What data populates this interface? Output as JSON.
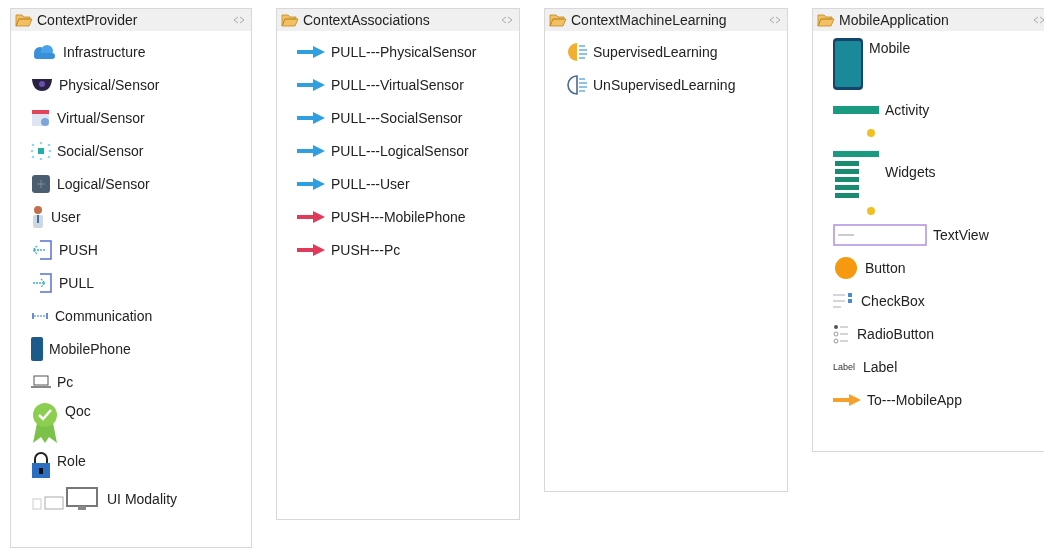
{
  "panels": [
    {
      "title": "ContextProvider",
      "items": [
        {
          "label": "Infrastructure",
          "kind": "cloud"
        },
        {
          "label": "Physical/Sensor",
          "kind": "camera"
        },
        {
          "label": "Virtual/Sensor",
          "kind": "calendar"
        },
        {
          "label": "Social/Sensor",
          "kind": "dots"
        },
        {
          "label": "Logical/Sensor",
          "kind": "chip"
        },
        {
          "label": "User",
          "kind": "person"
        },
        {
          "label": "PUSH",
          "kind": "push"
        },
        {
          "label": "PULL",
          "kind": "pull"
        },
        {
          "label": "Communication",
          "kind": "link"
        },
        {
          "label": "MobilePhone",
          "kind": "phone"
        },
        {
          "label": "Pc",
          "kind": "laptop"
        },
        {
          "label": "Qoc",
          "kind": "award"
        },
        {
          "label": "Role",
          "kind": "lock"
        },
        {
          "label": "UI Modality",
          "kind": "devices"
        }
      ]
    },
    {
      "title": "ContextAssociations",
      "items": [
        {
          "label": "PULL---PhysicalSensor",
          "kind": "arrow-blue"
        },
        {
          "label": "PULL---VirtualSensor",
          "kind": "arrow-blue"
        },
        {
          "label": "PULL---SocialSensor",
          "kind": "arrow-blue"
        },
        {
          "label": "PULL---LogicalSensor",
          "kind": "arrow-blue"
        },
        {
          "label": "PULL---User",
          "kind": "arrow-blue"
        },
        {
          "label": "PUSH---MobilePhone",
          "kind": "arrow-red"
        },
        {
          "label": "PUSH---Pc",
          "kind": "arrow-red"
        }
      ]
    },
    {
      "title": "ContextMachineLearning",
      "items": [
        {
          "label": "SupervisedLearning",
          "kind": "brain-yellow"
        },
        {
          "label": "UnSupervisedLearning",
          "kind": "brain-blue"
        }
      ]
    },
    {
      "title": "MobileApplication",
      "items": [
        {
          "label": "Mobile",
          "kind": "mobile"
        },
        {
          "label": "Activity",
          "kind": "activity"
        },
        {
          "label": "Widgets",
          "kind": "widgets"
        },
        {
          "label": "TextView",
          "kind": "textview"
        },
        {
          "label": "Button",
          "kind": "button"
        },
        {
          "label": "CheckBox",
          "kind": "checkbox"
        },
        {
          "label": "RadioButton",
          "kind": "radio"
        },
        {
          "label": "Label",
          "kind": "label",
          "icon_text": "Label"
        },
        {
          "label": "To---MobileApp",
          "kind": "arrow-orange"
        }
      ]
    }
  ]
}
